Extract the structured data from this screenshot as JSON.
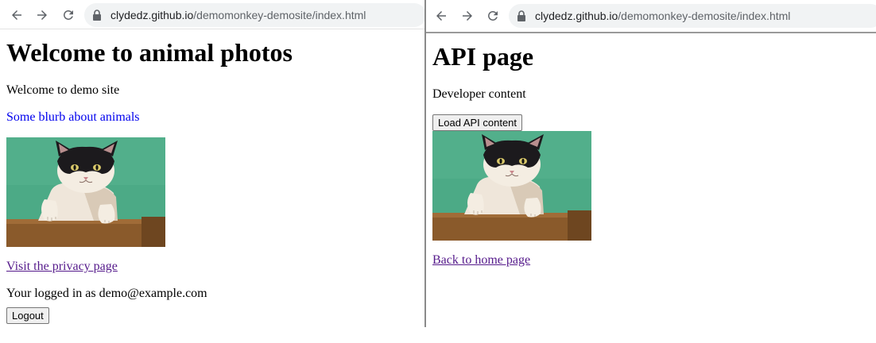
{
  "left": {
    "address_bar": {
      "host": "clydedz.github.io",
      "path": "/demomonkey-demosite/index.html"
    },
    "page": {
      "heading": "Welcome to animal photos",
      "intro": "Welcome to demo site",
      "blurb": "Some blurb about animals",
      "privacy_link": "Visit the privacy page",
      "logged_in_text": "Your logged in as demo@example.com",
      "logout_button": "Logout"
    }
  },
  "right": {
    "address_bar": {
      "host": "clydedz.github.io",
      "path": "/demomonkey-demosite/index.html"
    },
    "page": {
      "heading": "API page",
      "intro": "Developer content",
      "load_button": "Load API content",
      "home_link": "Back to home page"
    }
  },
  "icons": {
    "back": "back-arrow-icon",
    "forward": "forward-arrow-icon",
    "reload": "reload-icon",
    "lock": "lock-icon"
  },
  "colors": {
    "blurb": "#0000ee",
    "visited_link": "#551a8b",
    "omnibox_bg": "#f1f3f4",
    "cat_background": "#4caa86"
  }
}
